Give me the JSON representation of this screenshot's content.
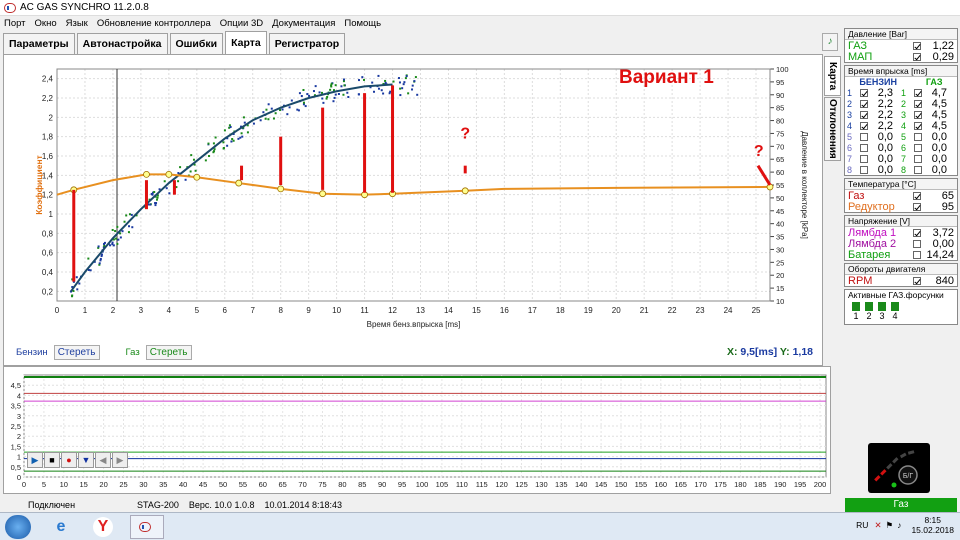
{
  "window": {
    "title": "AC GAS SYNCHRO  11.2.0.8"
  },
  "menu": [
    "Порт",
    "Окно",
    "Язык",
    "Обновление контроллера",
    "Опции 3D",
    "Документация",
    "Помощь"
  ],
  "tabs": [
    "Параметры",
    "Автонастройка",
    "Ошибки",
    "Карта",
    "Регистратор"
  ],
  "active_tab": "Карта",
  "vtabs": [
    "Карта",
    "Отклонения"
  ],
  "map_chart": {
    "title": "Вариант 1",
    "xlabel": "Время бенз.впрыска [ms]",
    "ylabel_left": "Коэффициент",
    "ylabel_right": "Давление в коллекторе [kPa]",
    "x_ticks": [
      "0",
      "1",
      "2",
      "3",
      "4",
      "5",
      "6",
      "7",
      "8",
      "9",
      "10",
      "11",
      "12",
      "13",
      "14",
      "15",
      "16",
      "17",
      "18",
      "19",
      "20",
      "21",
      "22",
      "23",
      "24",
      "25"
    ],
    "y_left_ticks": [
      "0,2",
      "0,4",
      "0,6",
      "0,8",
      "1",
      "1,2",
      "1,4",
      "1,6",
      "1,8",
      "2",
      "2,2",
      "2,4"
    ],
    "y_right_ticks": [
      "10",
      "15",
      "20",
      "25",
      "30",
      "35",
      "40",
      "45",
      "50",
      "55",
      "60",
      "65",
      "70",
      "75",
      "80",
      "85",
      "90",
      "95",
      "100"
    ],
    "question_marks": [
      "?",
      "?"
    ]
  },
  "chart_data": [
    {
      "type": "line",
      "title": "Вариант 1",
      "xlabel": "Время бенз.впрыска [ms]",
      "ylabel": "Коэффициент",
      "xlim": [
        0,
        25.5
      ],
      "ylim": [
        0.1,
        2.5
      ],
      "grid": true,
      "series": [
        {
          "kind": "coefficient",
          "x": [
            0,
            0.6,
            2,
            3.2,
            4,
            5,
            6.5,
            8,
            9.5,
            11,
            12,
            14.6,
            16,
            20,
            25.5
          ],
          "y": [
            1.2,
            1.25,
            1.35,
            1.41,
            1.41,
            1.38,
            1.32,
            1.26,
            1.21,
            1.2,
            1.21,
            1.24,
            1.26,
            1.27,
            1.28
          ]
        },
        {
          "kind": "coefficient-nodes",
          "x": [
            0.6,
            3.2,
            4,
            5,
            6.5,
            8,
            9.5,
            11,
            12,
            14.6,
            25.5
          ],
          "y": [
            1.25,
            1.41,
            1.41,
            1.38,
            1.32,
            1.26,
            1.21,
            1.2,
            1.21,
            1.24,
            1.28
          ]
        },
        {
          "kind": "pressure-fit",
          "x": [
            0.5,
            1,
            2,
            3,
            4,
            5,
            6,
            7,
            8,
            9,
            10,
            11,
            12
          ],
          "y": [
            0.2,
            0.4,
            0.75,
            1.05,
            1.32,
            1.55,
            1.78,
            1.97,
            2.1,
            2.2,
            2.27,
            2.32,
            2.34
          ]
        },
        {
          "kind": "deviation-marks",
          "x": [
            0.6,
            3.2,
            4.2,
            6.6,
            8,
            9.5,
            11,
            12,
            14.6,
            25.5
          ],
          "y_from": [
            1.25,
            1.35,
            1.35,
            1.35,
            1.3,
            1.25,
            1.22,
            1.22,
            1.42,
            1.3
          ],
          "y_to": [
            0.3,
            1.05,
            1.2,
            1.5,
            1.8,
            2.1,
            2.25,
            2.33,
            1.5,
            1.5
          ]
        }
      ]
    }
  ],
  "legend": {
    "benzin": "Бензин",
    "gas": "Газ",
    "clear": "Стереть",
    "x_label": "X:",
    "x_value": "9,5[ms]",
    "y_label": "Y:",
    "y_value": "1,18"
  },
  "lower_chart": {
    "y_ticks": [
      "0",
      "0,5",
      "1",
      "1,5",
      "2",
      "2,5",
      "3",
      "3,5",
      "4",
      "4,5"
    ],
    "x_ticks": [
      "0",
      "5",
      "10",
      "15",
      "20",
      "25",
      "30",
      "35",
      "40",
      "45",
      "50",
      "55",
      "60",
      "65",
      "70",
      "75",
      "80",
      "85",
      "90",
      "95",
      "100",
      "105",
      "110",
      "115",
      "120",
      "125",
      "130",
      "135",
      "140",
      "145",
      "150",
      "155",
      "160",
      "165",
      "170",
      "175",
      "180",
      "185",
      "190",
      "195",
      "200"
    ]
  },
  "status": {
    "state": "Подключен",
    "device": "STAG-200",
    "version": "Верс. 10.0  1.0.8",
    "datetime": "10.01.2014 8:18:43",
    "fuel": "Газ"
  },
  "pressure": {
    "header": "Давление [Bar]",
    "rows": [
      {
        "name": "ГАЗ",
        "value": "1,22",
        "color": "#10a010"
      },
      {
        "name": "МАП",
        "value": "0,29",
        "color": "#10a010"
      }
    ]
  },
  "injection": {
    "header": "Время впрыска [ms]",
    "col1": "БЕНЗИН",
    "col2": "ГАЗ",
    "rows": [
      {
        "n1": "1",
        "v1": "2,3",
        "n2": "1",
        "v2": "4,7"
      },
      {
        "n1": "2",
        "v1": "2,2",
        "n2": "2",
        "v2": "4,5"
      },
      {
        "n1": "3",
        "v1": "2,2",
        "n2": "3",
        "v2": "4,5"
      },
      {
        "n1": "4",
        "v1": "2,2",
        "n2": "4",
        "v2": "4,5"
      },
      {
        "n1": "5",
        "v1": "0,0",
        "n2": "5",
        "v2": "0,0"
      },
      {
        "n1": "6",
        "v1": "0,0",
        "n2": "6",
        "v2": "0,0"
      },
      {
        "n1": "7",
        "v1": "0,0",
        "n2": "7",
        "v2": "0,0"
      },
      {
        "n1": "8",
        "v1": "0,0",
        "n2": "8",
        "v2": "0,0"
      }
    ]
  },
  "temperature": {
    "header": "Температура [°C]",
    "rows": [
      {
        "name": "Газ",
        "value": "65",
        "color": "#c01010"
      },
      {
        "name": "Редуктор",
        "value": "95",
        "color": "#e07020"
      }
    ]
  },
  "voltage": {
    "header": "Напряжение [V]",
    "rows": [
      {
        "name": "Лямбда 1",
        "value": "3,72",
        "color": "#c010c0"
      },
      {
        "name": "Лямбда 2",
        "value": "0,00",
        "color": "#a010a0"
      },
      {
        "name": "Батарея",
        "value": "14,24",
        "color": "#10a010"
      }
    ]
  },
  "rpm": {
    "header": "Обороты двигателя",
    "name": "RPM",
    "value": "840",
    "color": "#c01010"
  },
  "active_injectors": {
    "header": "Активные ГАЗ.форсунки",
    "items": [
      "1",
      "2",
      "3",
      "4"
    ]
  },
  "gauge": {
    "label": "Б/Г"
  },
  "taskbar": {
    "lang": "RU",
    "time": "8:15",
    "date": "15.02.2018"
  }
}
